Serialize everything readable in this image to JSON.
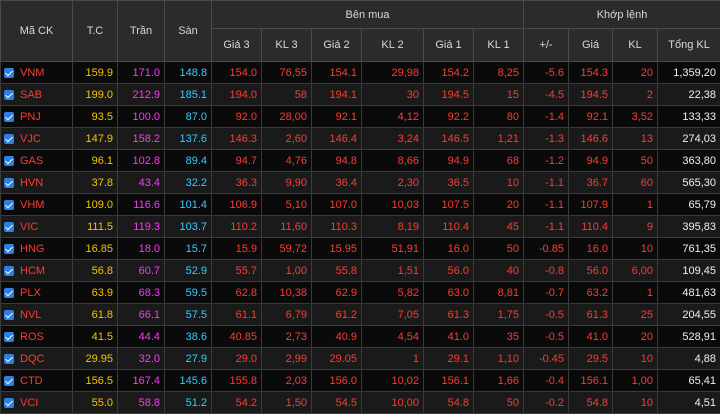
{
  "headers": {
    "symbol": "Mã CK",
    "ref": "T.C",
    "ceil": "Trần",
    "floor": "Sàn",
    "buy_group": "Bên mua",
    "match_group": "Khớp lệnh",
    "g3": "Giá 3",
    "kl3": "KL 3",
    "g2": "Giá 2",
    "kl2": "KL 2",
    "g1": "Giá 1",
    "kl1": "KL 1",
    "chg": "+/-",
    "price": "Giá",
    "kl": "KL",
    "total": "Tổng KL"
  },
  "rows": [
    {
      "sym": "VNM",
      "tc": "159.9",
      "tran": "171.0",
      "san": "148.8",
      "g3": "154.0",
      "kl3": "76,55",
      "g2": "154.1",
      "kl2": "29,98",
      "g1": "154.2",
      "kl1": "8,25",
      "chg": "-5.6",
      "price": "154.3",
      "kl": "20",
      "total": "1,359,20"
    },
    {
      "sym": "SAB",
      "tc": "199.0",
      "tran": "212.9",
      "san": "185.1",
      "g3": "194.0",
      "kl3": "58",
      "g2": "194.1",
      "kl2": "30",
      "g1": "194.5",
      "kl1": "15",
      "chg": "-4.5",
      "price": "194.5",
      "kl": "2",
      "total": "22,38"
    },
    {
      "sym": "PNJ",
      "tc": "93.5",
      "tran": "100.0",
      "san": "87.0",
      "g3": "92.0",
      "kl3": "28,00",
      "g2": "92.1",
      "kl2": "4,12",
      "g1": "92.2",
      "kl1": "80",
      "chg": "-1.4",
      "price": "92.1",
      "kl": "3,52",
      "total": "133,33"
    },
    {
      "sym": "VJC",
      "tc": "147.9",
      "tran": "158.2",
      "san": "137.6",
      "g3": "146.3",
      "kl3": "2,60",
      "g2": "146.4",
      "kl2": "3,24",
      "g1": "146.5",
      "kl1": "1,21",
      "chg": "-1.3",
      "price": "146.6",
      "kl": "13",
      "total": "274,03"
    },
    {
      "sym": "GAS",
      "tc": "96.1",
      "tran": "102.8",
      "san": "89.4",
      "g3": "94.7",
      "kl3": "4,76",
      "g2": "94.8",
      "kl2": "8,66",
      "g1": "94.9",
      "kl1": "68",
      "chg": "-1.2",
      "price": "94.9",
      "kl": "50",
      "total": "363,80"
    },
    {
      "sym": "HVN",
      "tc": "37.8",
      "tran": "43.4",
      "san": "32.2",
      "g3": "36.3",
      "kl3": "9,90",
      "g2": "36.4",
      "kl2": "2,30",
      "g1": "36.5",
      "kl1": "10",
      "chg": "-1.1",
      "price": "36.7",
      "kl": "60",
      "total": "565,30"
    },
    {
      "sym": "VHM",
      "tc": "109.0",
      "tran": "116.6",
      "san": "101.4",
      "g3": "106.9",
      "kl3": "5,10",
      "g2": "107.0",
      "kl2": "10,03",
      "g1": "107.5",
      "kl1": "20",
      "chg": "-1.1",
      "price": "107.9",
      "kl": "1",
      "total": "65,79"
    },
    {
      "sym": "VIC",
      "tc": "111.5",
      "tran": "119.3",
      "san": "103.7",
      "g3": "110.2",
      "kl3": "11,60",
      "g2": "110.3",
      "kl2": "8,19",
      "g1": "110.4",
      "kl1": "45",
      "chg": "-1.1",
      "price": "110.4",
      "kl": "9",
      "total": "395,83"
    },
    {
      "sym": "HNG",
      "tc": "16.85",
      "tran": "18.0",
      "san": "15.7",
      "g3": "15.9",
      "kl3": "59,72",
      "g2": "15.95",
      "kl2": "51,91",
      "g1": "16.0",
      "kl1": "50",
      "chg": "-0.85",
      "price": "16.0",
      "kl": "10",
      "total": "761,35"
    },
    {
      "sym": "HCM",
      "tc": "56.8",
      "tran": "60.7",
      "san": "52.9",
      "g3": "55.7",
      "kl3": "1,00",
      "g2": "55.8",
      "kl2": "1,51",
      "g1": "56.0",
      "kl1": "40",
      "chg": "-0.8",
      "price": "56.0",
      "kl": "6,00",
      "total": "109,45"
    },
    {
      "sym": "PLX",
      "tc": "63.9",
      "tran": "68.3",
      "san": "59.5",
      "g3": "62.8",
      "kl3": "10,38",
      "g2": "62.9",
      "kl2": "5,82",
      "g1": "63.0",
      "kl1": "8,81",
      "chg": "-0.7",
      "price": "63.2",
      "kl": "1",
      "total": "481,63"
    },
    {
      "sym": "NVL",
      "tc": "61.8",
      "tran": "66.1",
      "san": "57.5",
      "g3": "61.1",
      "kl3": "6,79",
      "g2": "61.2",
      "kl2": "7,05",
      "g1": "61.3",
      "kl1": "1,75",
      "chg": "-0.5",
      "price": "61.3",
      "kl": "25",
      "total": "204,55"
    },
    {
      "sym": "ROS",
      "tc": "41.5",
      "tran": "44.4",
      "san": "38.6",
      "g3": "40.85",
      "kl3": "2,73",
      "g2": "40.9",
      "kl2": "4,54",
      "g1": "41.0",
      "kl1": "35",
      "chg": "-0.5",
      "price": "41.0",
      "kl": "20",
      "total": "528,91"
    },
    {
      "sym": "DQC",
      "tc": "29.95",
      "tran": "32.0",
      "san": "27.9",
      "g3": "29.0",
      "kl3": "2,99",
      "g2": "29.05",
      "kl2": "1",
      "g1": "29.1",
      "kl1": "1,10",
      "chg": "-0.45",
      "price": "29.5",
      "kl": "10",
      "total": "4,88"
    },
    {
      "sym": "CTD",
      "tc": "156.5",
      "tran": "167.4",
      "san": "145.6",
      "g3": "155.8",
      "kl3": "2,03",
      "g2": "156.0",
      "kl2": "10,02",
      "g1": "156.1",
      "kl1": "1,66",
      "chg": "-0.4",
      "price": "156.1",
      "kl": "1,00",
      "total": "65,41"
    },
    {
      "sym": "VCI",
      "tc": "55.0",
      "tran": "58.8",
      "san": "51.2",
      "g3": "54.2",
      "kl3": "1,50",
      "g2": "54.5",
      "kl2": "10,00",
      "g1": "54.8",
      "kl1": "50",
      "chg": "-0.2",
      "price": "54.8",
      "kl": "10",
      "total": "4,51"
    }
  ]
}
